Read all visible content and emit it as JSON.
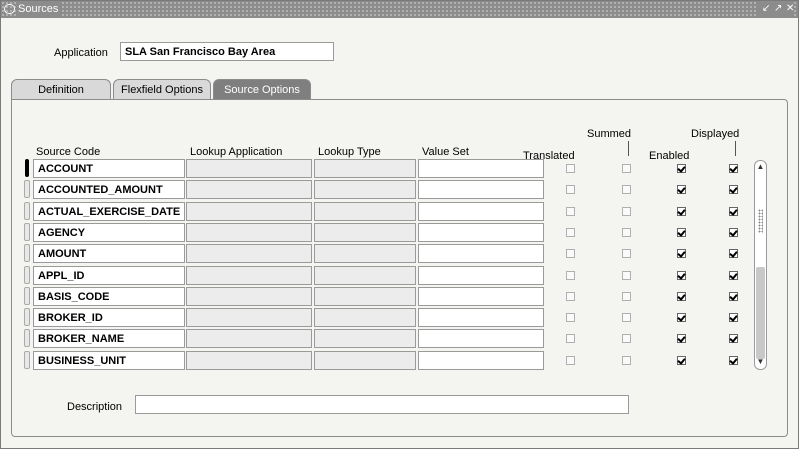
{
  "window": {
    "title": "Sources",
    "controls": [
      "↙",
      "↗",
      "✕"
    ]
  },
  "application": {
    "label": "Application",
    "value": "SLA San Francisco Bay Area"
  },
  "tabs": [
    {
      "label": "Definition",
      "active": false
    },
    {
      "label": "Flexfield Options",
      "active": false
    },
    {
      "label": "Source Options",
      "active": true
    }
  ],
  "grid": {
    "headers": {
      "source_code": "Source Code",
      "lookup_application": "Lookup Application",
      "lookup_type": "Lookup Type",
      "value_set": "Value Set",
      "translated": "Translated",
      "summed": "Summed",
      "enabled": "Enabled",
      "displayed": "Displayed"
    },
    "rows": [
      {
        "source_code": "ACCOUNT",
        "lookup_application": "",
        "lookup_type": "",
        "value_set": "",
        "translated": false,
        "summed": false,
        "enabled": true,
        "displayed": true
      },
      {
        "source_code": "ACCOUNTED_AMOUNT",
        "lookup_application": "",
        "lookup_type": "",
        "value_set": "",
        "translated": false,
        "summed": false,
        "enabled": true,
        "displayed": true
      },
      {
        "source_code": "ACTUAL_EXERCISE_DATE",
        "lookup_application": "",
        "lookup_type": "",
        "value_set": "",
        "translated": false,
        "summed": false,
        "enabled": true,
        "displayed": true
      },
      {
        "source_code": "AGENCY",
        "lookup_application": "",
        "lookup_type": "",
        "value_set": "",
        "translated": false,
        "summed": false,
        "enabled": true,
        "displayed": true
      },
      {
        "source_code": "AMOUNT",
        "lookup_application": "",
        "lookup_type": "",
        "value_set": "",
        "translated": false,
        "summed": false,
        "enabled": true,
        "displayed": true
      },
      {
        "source_code": "APPL_ID",
        "lookup_application": "",
        "lookup_type": "",
        "value_set": "",
        "translated": false,
        "summed": false,
        "enabled": true,
        "displayed": true
      },
      {
        "source_code": "BASIS_CODE",
        "lookup_application": "",
        "lookup_type": "",
        "value_set": "",
        "translated": false,
        "summed": false,
        "enabled": true,
        "displayed": true
      },
      {
        "source_code": "BROKER_ID",
        "lookup_application": "",
        "lookup_type": "",
        "value_set": "",
        "translated": false,
        "summed": false,
        "enabled": true,
        "displayed": true
      },
      {
        "source_code": "BROKER_NAME",
        "lookup_application": "",
        "lookup_type": "",
        "value_set": "",
        "translated": false,
        "summed": false,
        "enabled": true,
        "displayed": true
      },
      {
        "source_code": "BUSINESS_UNIT",
        "lookup_application": "",
        "lookup_type": "",
        "value_set": "",
        "translated": false,
        "summed": false,
        "enabled": true,
        "displayed": true
      }
    ],
    "current_row": 0
  },
  "description": {
    "label": "Description",
    "value": ""
  },
  "scrollbar": {
    "up_icon": "up-arrow-icon",
    "down_icon": "down-arrow-icon"
  }
}
